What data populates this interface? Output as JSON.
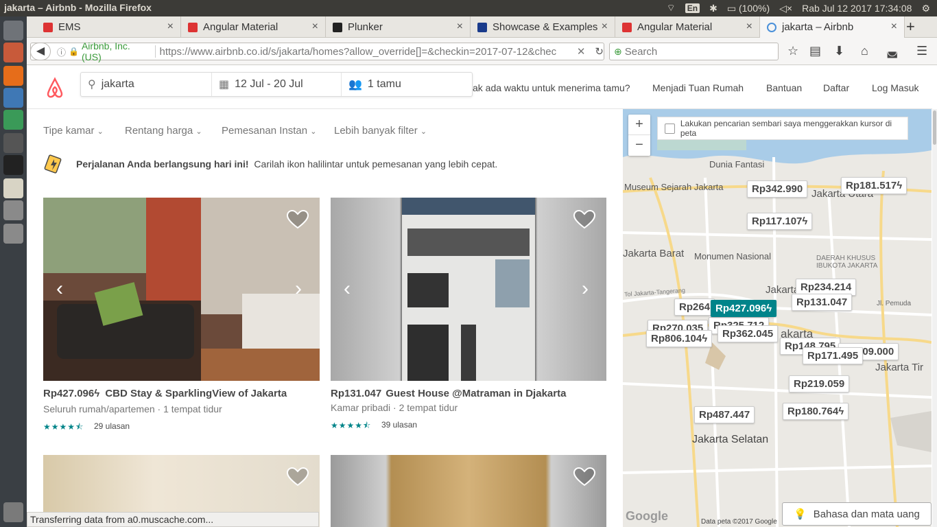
{
  "system": {
    "window_title": "jakarta – Airbnb - Mozilla Firefox",
    "keyboard": "En",
    "battery": "(100%)",
    "datetime": "Rab Jul 12 2017 17:34:08"
  },
  "tabs": [
    {
      "label": "EMS",
      "favicon_color": "#dd3333"
    },
    {
      "label": "Angular Material",
      "favicon_color": "#dd3333"
    },
    {
      "label": "Plunker",
      "favicon_color": "#222222"
    },
    {
      "label": "Showcase & Examples",
      "favicon_color": "#1a3b8b"
    },
    {
      "label": "Angular Material",
      "favicon_color": "#dd3333"
    },
    {
      "label": "jakarta – Airbnb",
      "favicon_color": "#4a90d9"
    }
  ],
  "navbar": {
    "site_identity": "Airbnb, Inc. (US)",
    "url": "https://www.airbnb.co.id/s/jakarta/homes?allow_override[]=&checkin=2017-07-12&chec",
    "search_placeholder": "Search"
  },
  "airbnb": {
    "search_location": "jakarta",
    "dates": "12 Jul - 20 Jul",
    "guests": "1 tamu",
    "host_prompt": "ak ada waktu untuk menerima tamu?",
    "become_host": "Menjadi Tuan Rumah",
    "help": "Bantuan",
    "signup": "Daftar",
    "login": "Log Masuk"
  },
  "filters": [
    "Tipe kamar",
    "Rentang harga",
    "Pemesanan Instan",
    "Lebih banyak filter"
  ],
  "banner": {
    "bold": "Perjalanan Anda berlangsung hari ini!",
    "text": "Carilah ikon halilintar untuk pemesanan yang lebih cepat."
  },
  "listings": [
    {
      "price": "Rp427.096",
      "instant": true,
      "title": "CBD Stay & SparklingView of Jakarta",
      "subtitle": "Seluruh rumah/apartemen · 1 tempat tidur",
      "rating": 4.5,
      "reviews": "29 ulasan"
    },
    {
      "price": "Rp131.047",
      "instant": false,
      "title": "Guest House @Matraman in Djakarta",
      "subtitle": "Kamar pribadi · 2 tempat tidur",
      "rating": 4.5,
      "reviews": "39 ulasan"
    }
  ],
  "map": {
    "move_search_label": "Lakukan pencarian sembari saya menggerakkan kursor di peta",
    "zoom_in": "+",
    "zoom_out": "−",
    "places": [
      "Dunia Fantasi",
      "Museum Sejarah Jakarta",
      "Jakarta Utara",
      "Monumen Nasional",
      "DAERAH KHUSUS IBUKOTA JAKARTA",
      "Jakarta Pu",
      "Jakarta Barat",
      "Jakarta Selatan",
      "Jakarta Tir",
      "akarta",
      "Jl. Pemuda",
      "Tol Jakarta-Tangerang"
    ],
    "prices": [
      "Rp342.990",
      "Rp181.517",
      "Rp117.107",
      "Rp234.214",
      "Rp131.047",
      "Rp264",
      "Rp427.096",
      "Rp270.035",
      "Rp325.712",
      "Rp806.104",
      "Rp362.045",
      "Rp148.795",
      "Rp171.495",
      "Rp209.000",
      "Rp219.059",
      "Rp487.447",
      "Rp180.764"
    ],
    "google": "Google",
    "data_credit": "Data peta ©2017 Google",
    "language_button": "Bahasa dan mata uang"
  },
  "status_text": "Transferring data from a0.muscache.com..."
}
